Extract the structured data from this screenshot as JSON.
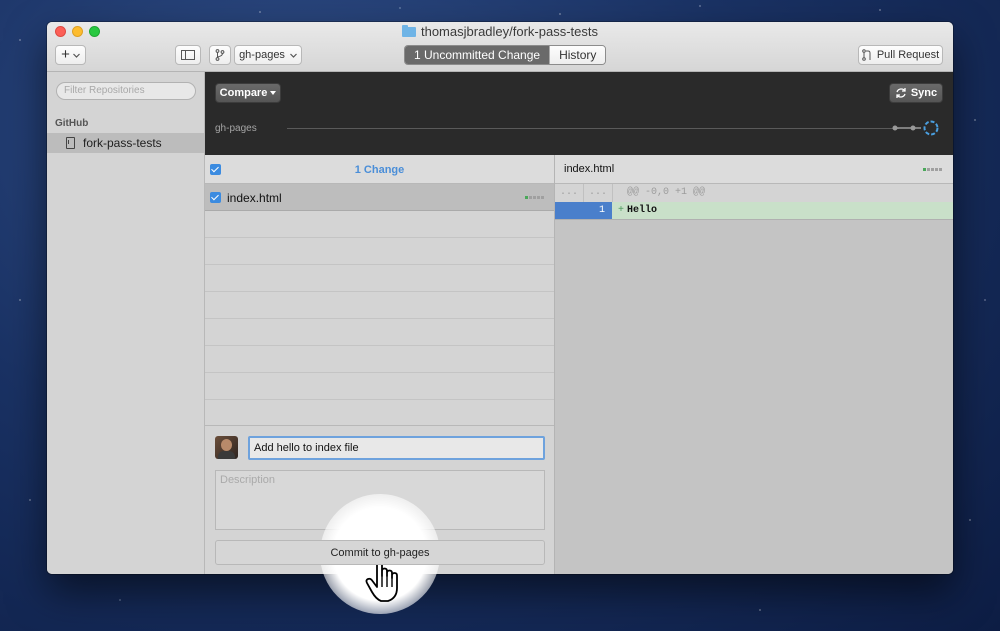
{
  "window": {
    "title": "thomasjbradley/fork-pass-tests"
  },
  "toolbar": {
    "add_symbol": "+",
    "branch_name": "gh-pages",
    "tabs": [
      {
        "label": "1 Uncommitted Change",
        "active": true
      },
      {
        "label": "History",
        "active": false
      }
    ],
    "pull_request_label": "Pull Request"
  },
  "sidebar": {
    "filter_placeholder": "Filter Repositories",
    "section_title": "GitHub",
    "repos": [
      {
        "name": "fork-pass-tests",
        "selected": true
      }
    ]
  },
  "topbar": {
    "compare_label": "Compare",
    "sync_label": "Sync",
    "branch_label": "gh-pages"
  },
  "changes": {
    "header": "1 Change",
    "files": [
      {
        "name": "index.html",
        "checked": true
      }
    ]
  },
  "commit": {
    "summary_value": "Add hello to index file",
    "description_placeholder": "Description",
    "button_label": "Commit to gh-pages"
  },
  "diff": {
    "filename": "index.html",
    "hunk": {
      "old_no": "...",
      "new_no": "...",
      "text": "@@ -0,0 +1 @@"
    },
    "lines": [
      {
        "new_no": "1",
        "sign": "+",
        "text": "Hello"
      }
    ]
  },
  "colors": {
    "accent": "#4a8ed8",
    "added_bg": "#c9e0c9",
    "topbar_bg": "#2a2a2a",
    "selection_blue": "#4a7fcb"
  }
}
